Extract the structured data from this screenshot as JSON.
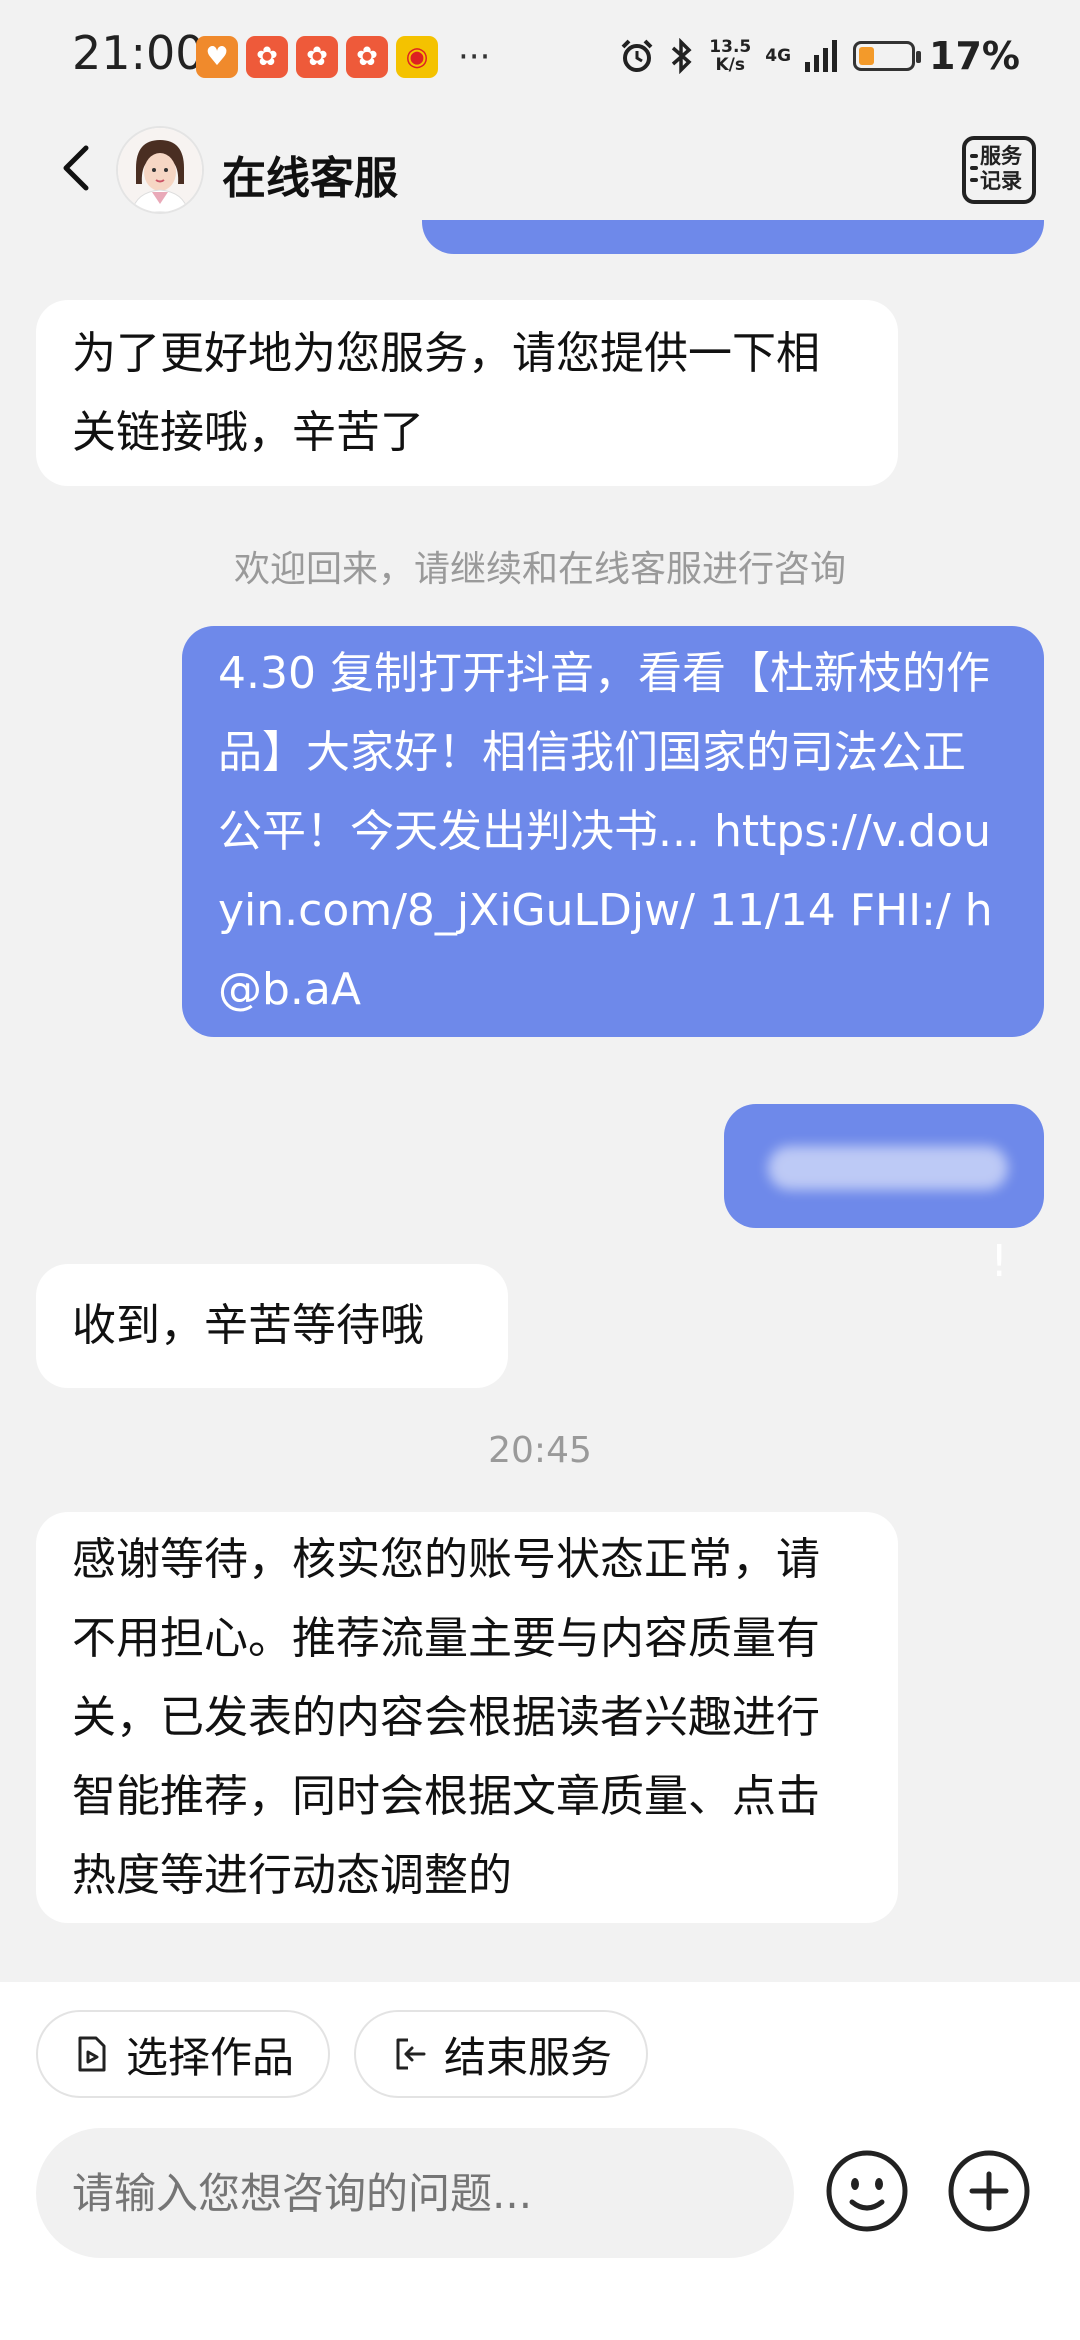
{
  "status_bar": {
    "time": "21:00",
    "more": "···",
    "speed_value": "13.5",
    "speed_unit": "K/s",
    "network": "4G",
    "battery_percent": "17%",
    "battery_level": 0.17,
    "app_icons": [
      "app-icon",
      "kuaishou-icon",
      "kuaishou-icon",
      "kuaishou-icon",
      "weibo-icon"
    ]
  },
  "header": {
    "title": "在线客服",
    "records_label_line1": "服务",
    "records_label_line2": "记录"
  },
  "chat": {
    "messages": [
      {
        "side": "left",
        "text": "为了更好地为您服务，请您提供一下相关链接哦，辛苦了"
      },
      {
        "side": "system",
        "text": "欢迎回来，请继续和在线客服进行咨询"
      },
      {
        "side": "right",
        "text": "4.30 复制打开抖音，看看【杜新枝的作品】大家好！相信我们国家的司法公正公平！今天发出判决书... https://v.douyin.com/8_jXiGuLDjw/ 11/14 FHI:/ h@b.aA"
      },
      {
        "side": "right",
        "text": "!"
      },
      {
        "side": "left",
        "text": "收到，辛苦等待哦"
      },
      {
        "side": "time",
        "text": "20:45"
      },
      {
        "side": "left",
        "text": "感谢等待，核实您的账号状态正常，请不用担心。推荐流量主要与内容质量有关，已发表的内容会根据读者兴趣进行智能推荐，同时会根据文章质量、点击热度等进行动态调整的"
      }
    ]
  },
  "actions": {
    "select_work": "选择作品",
    "end_service": "结束服务"
  },
  "input": {
    "placeholder": "请输入您想咨询的问题..."
  },
  "colors": {
    "accent_bubble": "#6e89ea",
    "background": "#f2f2f2"
  }
}
